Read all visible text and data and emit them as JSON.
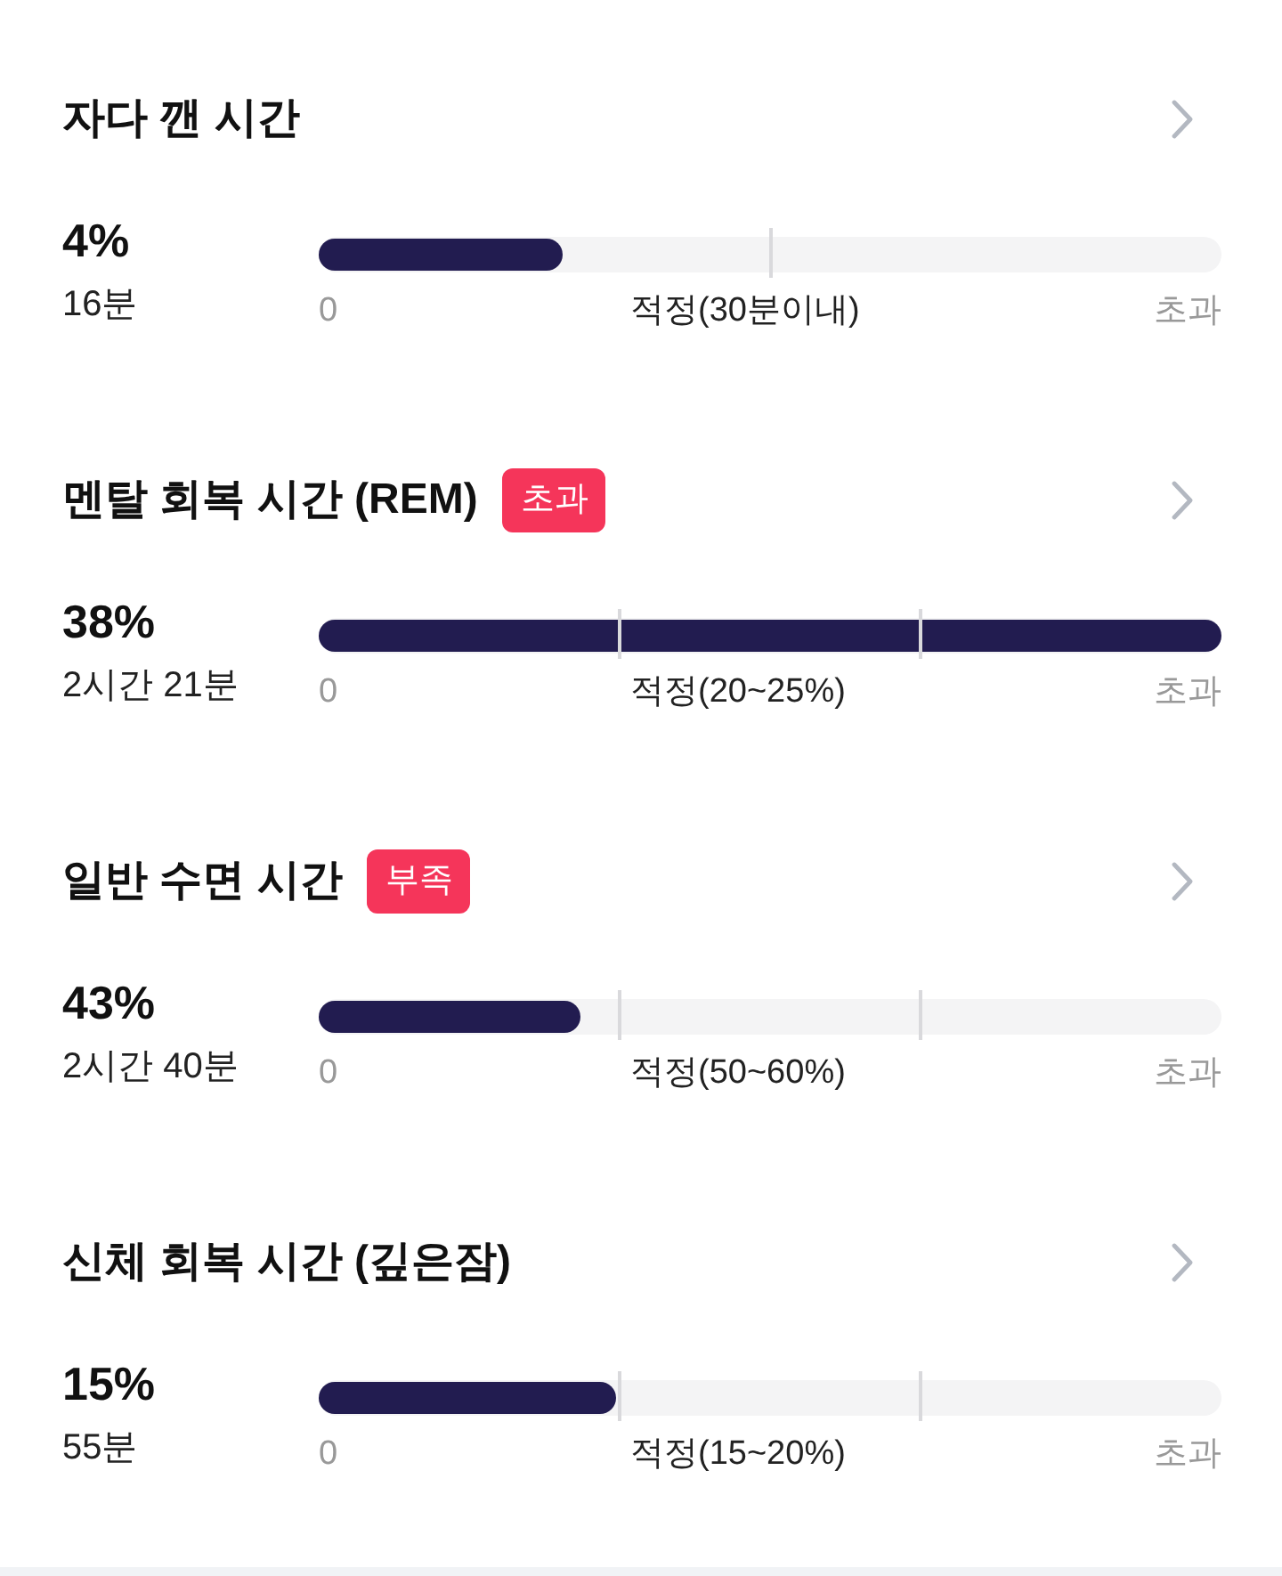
{
  "sections": [
    {
      "title": "자다 깬 시간",
      "percent": "4%",
      "duration": "16분",
      "bar": {
        "kind": "limit",
        "level": 0.27,
        "start_label": "0",
        "target_label": "적정(30분이내)",
        "end_label": "초과"
      }
    },
    {
      "title": "멘탈 회복 시간 (REM)",
      "badge": "초과",
      "percent": "38%",
      "duration": "2시간 21분",
      "bar": {
        "kind": "range",
        "level": 1,
        "start_label": "0",
        "target_label": "적정(20~25%)",
        "end_label": "초과"
      }
    },
    {
      "title": "일반 수면 시간",
      "badge": "부족",
      "percent": "43%",
      "duration": "2시간 40분",
      "bar": {
        "kind": "range",
        "level": 0.29,
        "start_label": "0",
        "target_label": "적정(50~60%)",
        "end_label": "초과"
      }
    },
    {
      "title": "신체 회복 시간 (깊은잠)",
      "percent": "15%",
      "duration": "55분",
      "bar": {
        "kind": "range",
        "level": 0.33,
        "start_label": "0",
        "target_label": "적정(15~20%)",
        "end_label": "초과"
      }
    }
  ]
}
